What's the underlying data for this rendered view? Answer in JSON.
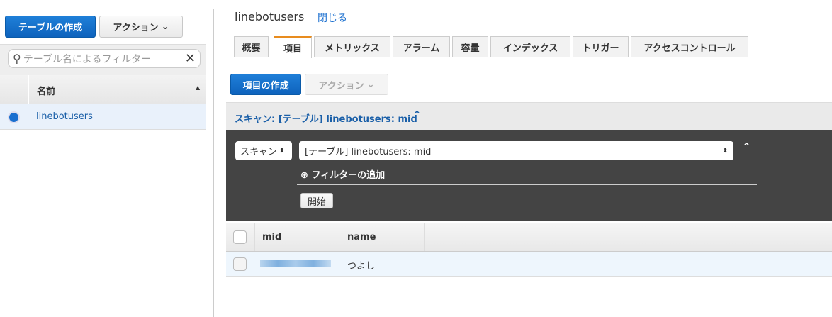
{
  "left": {
    "create_table": "テーブルの作成",
    "actions": "アクション",
    "filter_placeholder": "テーブル名によるフィルター",
    "column_name": "名前",
    "tables": [
      "linebotusers"
    ]
  },
  "header": {
    "title": "linebotusers",
    "close": "閉じる"
  },
  "tabs": [
    "概要",
    "項目",
    "メトリックス",
    "アラーム",
    "容量",
    "インデックス",
    "トリガー",
    "アクセスコントロール"
  ],
  "toolbar": {
    "create_item": "項目の作成",
    "actions": "アクション"
  },
  "scan": {
    "header": "スキャン: [テーブル] linebotusers: mid",
    "mode": "スキャン",
    "target": "[テーブル] linebotusers: mid",
    "add_filter": "フィルターの追加",
    "start": "開始"
  },
  "table": {
    "columns": [
      "mid",
      "name"
    ],
    "rows": [
      {
        "mid": "",
        "name": "つよし"
      }
    ]
  }
}
